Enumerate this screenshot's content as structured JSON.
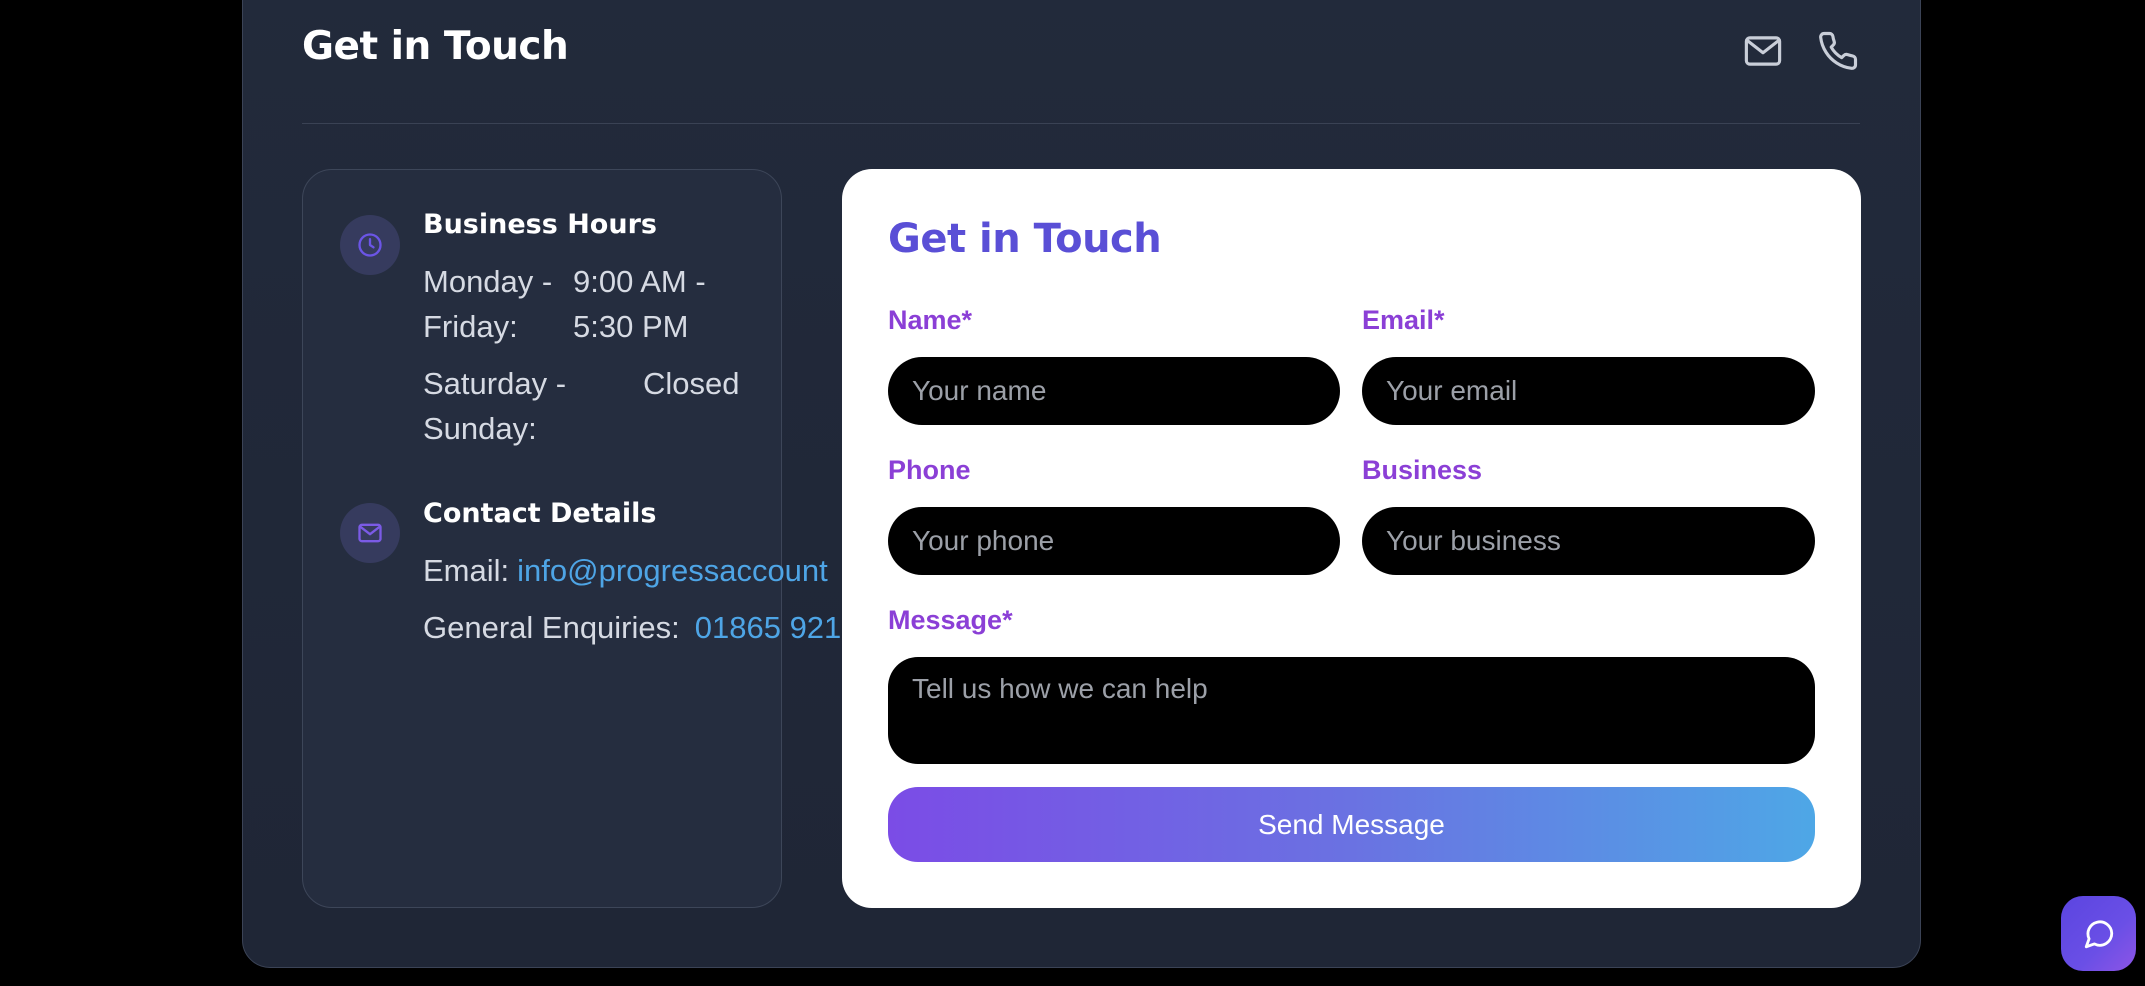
{
  "header": {
    "title": "Get in Touch",
    "icons": [
      "mail-icon",
      "phone-icon"
    ]
  },
  "business_hours": {
    "heading": "Business Hours",
    "icon": "clock-icon",
    "rows": [
      {
        "days": "Monday -\nFriday:",
        "time": "9:00 AM -\n5:30 PM"
      },
      {
        "days": "Saturday -\nSunday:",
        "time": "Closed"
      }
    ]
  },
  "contact_details": {
    "heading": "Contact Details",
    "icon": "mail-icon",
    "email_label": "Email:",
    "email_value": "info@progressaccount",
    "enquiries_label": "General Enquiries:",
    "enquiries_value": "01865 921"
  },
  "form": {
    "title": "Get in Touch",
    "name_label": "Name*",
    "name_placeholder": "Your name",
    "email_label": "Email*",
    "email_placeholder": "Your email",
    "phone_label": "Phone",
    "phone_placeholder": "Your phone",
    "business_label": "Business",
    "business_placeholder": "Your business",
    "message_label": "Message*",
    "message_placeholder": "Tell us how we can help",
    "submit_label": "Send Message"
  },
  "chat_widget": {
    "icon": "chat-bubble-icon"
  },
  "colors": {
    "page_background": "#000000",
    "panel_background": "#222a3b",
    "form_title": "#5a4fd6",
    "form_label": "#8b3fd6",
    "link": "#4ea5e6",
    "button_gradient_start": "#7b4ce6",
    "button_gradient_end": "#4ea7e6"
  }
}
